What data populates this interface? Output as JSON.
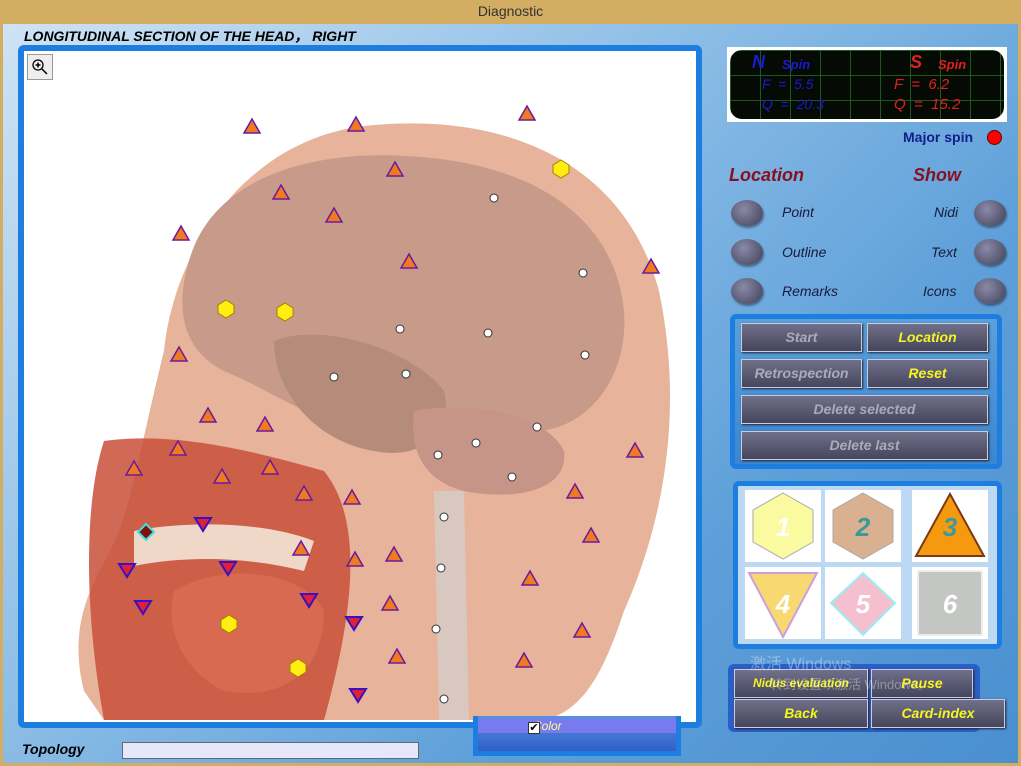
{
  "window": {
    "title": "Diagnostic"
  },
  "view": {
    "heading": "LONGITUDINAL SECTION OF THE HEAD， RIGHT",
    "zoom_icon": "zoom-in-icon"
  },
  "spin": {
    "n_label": "N",
    "n_spin": "Spin",
    "n_f": "F  =  5.5",
    "n_q": "Q  =  20.3",
    "s_label": "S",
    "s_spin": "Spin",
    "s_f": "F  =  6.2",
    "s_q": "Q  =  15.2",
    "major_label": "Major spin",
    "major_color": "#ff0000"
  },
  "location": {
    "title": "Location",
    "items": [
      "Point",
      "Outline",
      "Remarks"
    ]
  },
  "show": {
    "title": "Show",
    "items": [
      "Nidi",
      "Text",
      "Icons"
    ]
  },
  "controls": {
    "start": "Start",
    "location": "Location",
    "retrospection": "Retrospection",
    "reset": "Reset",
    "delete_selected": "Delete selected",
    "delete_last": "Delete last"
  },
  "shapes": [
    {
      "n": "1",
      "shape": "hexagon",
      "color": "#fafaa0"
    },
    {
      "n": "2",
      "shape": "hexagon",
      "color": "#d9b090"
    },
    {
      "n": "3",
      "shape": "triangle",
      "color": "#f59a10"
    },
    {
      "n": "4",
      "shape": "triangle-down",
      "color": "#f8d870"
    },
    {
      "n": "5",
      "shape": "diamond",
      "color": "#f4c0d0"
    },
    {
      "n": "6",
      "shape": "square",
      "color": "#c4c6c4"
    }
  ],
  "bottom": {
    "nidus": "Nidus evaluation",
    "pause": "Pause",
    "back": "Back",
    "card_index": "Card-index"
  },
  "color_toggle": {
    "label": "Color",
    "checked": true
  },
  "topology": {
    "label": "Topology",
    "value": ""
  },
  "watermark": {
    "line1": "激活 Windows",
    "line2": "转到设置以激活 Windows。"
  }
}
